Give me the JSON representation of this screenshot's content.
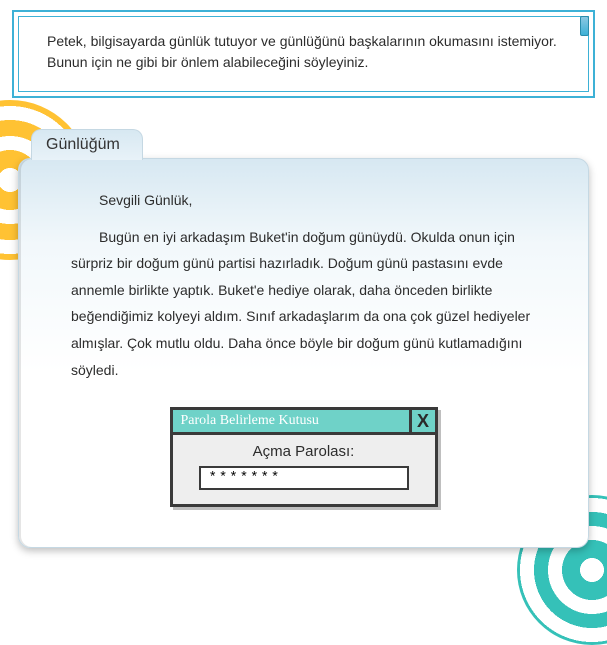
{
  "question": {
    "text": "Petek, bilgisayarda günlük tutuyor ve günlüğünü başkalarının okumasını istemiyor. Bunun için ne gibi bir önlem alabileceğini söyleyiniz."
  },
  "diary": {
    "tab_label": "Günlüğüm",
    "greeting": "Sevgili Günlük,",
    "paragraph": "Bugün en iyi arkadaşım Buket'in doğum günüydü. Okulda onun için sürpriz bir doğum günü partisi hazırladık. Doğum günü pastasını evde annemle birlikte yaptık. Buket'e hediye olarak, daha önceden birlikte beğendiğimiz kolyeyi aldım. Sınıf arkadaşlarım da ona çok güzel hediyeler almışlar. Çok mutlu oldu. Daha önce böyle bir doğum günü kutlamadığını söyledi."
  },
  "password_dialog": {
    "title": "Parola Belirleme Kutusu",
    "close_label": "X",
    "field_label": "Açma Parolası:",
    "masked_value": "*******"
  },
  "colors": {
    "accent_blue": "#3db1d6",
    "swirl_yellow": "#ffc233",
    "swirl_teal": "#35c1b8",
    "dialog_header": "#6fd2c8"
  }
}
